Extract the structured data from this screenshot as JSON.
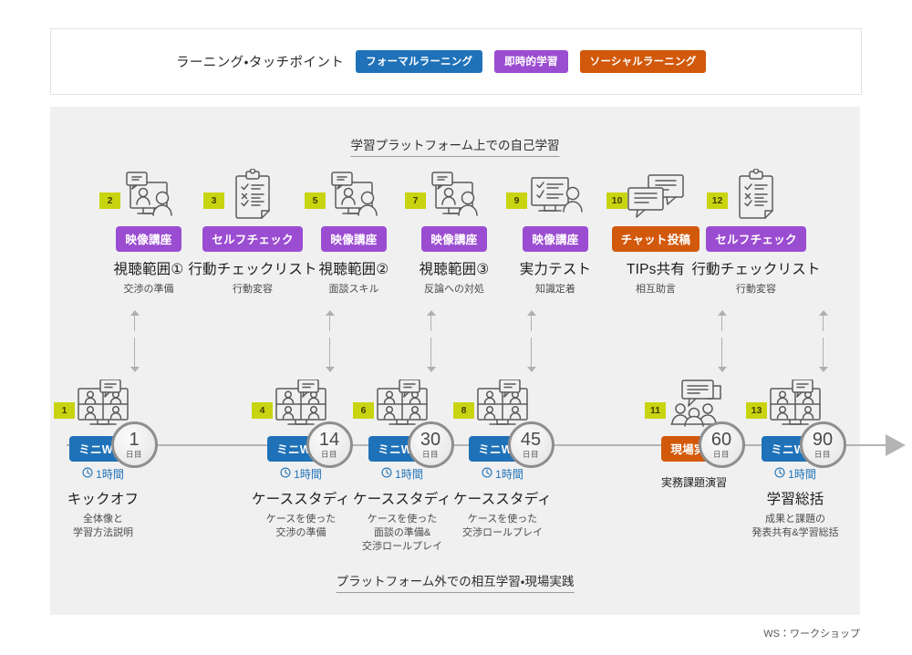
{
  "legend": {
    "title": "ラーニング・タッチポイント",
    "chips": [
      {
        "label": "フォーマルラーニング",
        "color": "#1f72b8"
      },
      {
        "label": "即時的学習",
        "color": "#9b4dd1"
      },
      {
        "label": "ソーシャルラーニング",
        "color": "#d2590b"
      }
    ]
  },
  "headings": {
    "top": "学習プラットフォーム上での自己学習",
    "bottom": "プラットフォーム外での相互学習・現場実践"
  },
  "timeline": {
    "unit": "日目",
    "days": [
      "1",
      "14",
      "30",
      "45",
      "60",
      "90"
    ]
  },
  "top_cards": [
    {
      "num": "2",
      "icon": "video-lecture-icon",
      "chip": "映像講座",
      "chip_color": "#9b4dd1",
      "title": "視聴範囲①",
      "sub": "交渉の準備"
    },
    {
      "num": "3",
      "icon": "checklist-icon",
      "chip": "セルフチェック",
      "chip_color": "#9b4dd1",
      "title": "行動チェックリスト",
      "sub": "行動変容"
    },
    {
      "num": "5",
      "icon": "video-lecture-icon",
      "chip": "映像講座",
      "chip_color": "#9b4dd1",
      "title": "視聴範囲②",
      "sub": "面談スキル"
    },
    {
      "num": "7",
      "icon": "video-lecture-icon",
      "chip": "映像講座",
      "chip_color": "#9b4dd1",
      "title": "視聴範囲③",
      "sub": "反論への対処"
    },
    {
      "num": "9",
      "icon": "test-monitor-icon",
      "chip": "映像講座",
      "chip_color": "#9b4dd1",
      "title": "実力テスト",
      "sub": "知識定着"
    },
    {
      "num": "10",
      "icon": "chat-bubbles-icon",
      "chip": "チャット投稿",
      "chip_color": "#d2590b",
      "title": "TIPs共有",
      "sub": "相互助言"
    },
    {
      "num": "12",
      "icon": "checklist-icon",
      "chip": "セルフチェック",
      "chip_color": "#9b4dd1",
      "title": "行動チェックリスト",
      "sub": "行動変容"
    }
  ],
  "bottom_cards": [
    {
      "num": "1",
      "icon": "video-meeting-icon",
      "chip": "ミニWS1",
      "chip_color": "#1f72b8",
      "duration": "1時間",
      "title": "キックオフ",
      "sub": "全体像と\n学習方法説明"
    },
    {
      "num": "4",
      "icon": "video-meeting-icon",
      "chip": "ミニWS2",
      "chip_color": "#1f72b8",
      "duration": "1時間",
      "title": "ケーススタディ",
      "sub": "ケースを使った\n交渉の準備"
    },
    {
      "num": "6",
      "icon": "video-meeting-icon",
      "chip": "ミニWS3",
      "chip_color": "#1f72b8",
      "duration": "1時間",
      "title": "ケーススタディ",
      "sub": "ケースを使った\n面談の準備&\n交渉ロールプレイ"
    },
    {
      "num": "8",
      "icon": "video-meeting-icon",
      "chip": "ミニWS4",
      "chip_color": "#1f72b8",
      "duration": "1時間",
      "title": "ケーススタディ",
      "sub": "ケースを使った\n交渉ロールプレイ"
    },
    {
      "num": "11",
      "icon": "group-discussion-icon",
      "chip": "現場実践",
      "chip_color": "#d2590b",
      "duration": "",
      "title": "",
      "sub": "実務課題演習"
    },
    {
      "num": "13",
      "icon": "video-meeting-icon",
      "chip": "ミニWS5",
      "chip_color": "#1f72b8",
      "duration": "1時間",
      "title": "学習総括",
      "sub": "成果と課題の\n発表共有&学習総括"
    }
  ],
  "footnote": "WS：ワークショップ"
}
